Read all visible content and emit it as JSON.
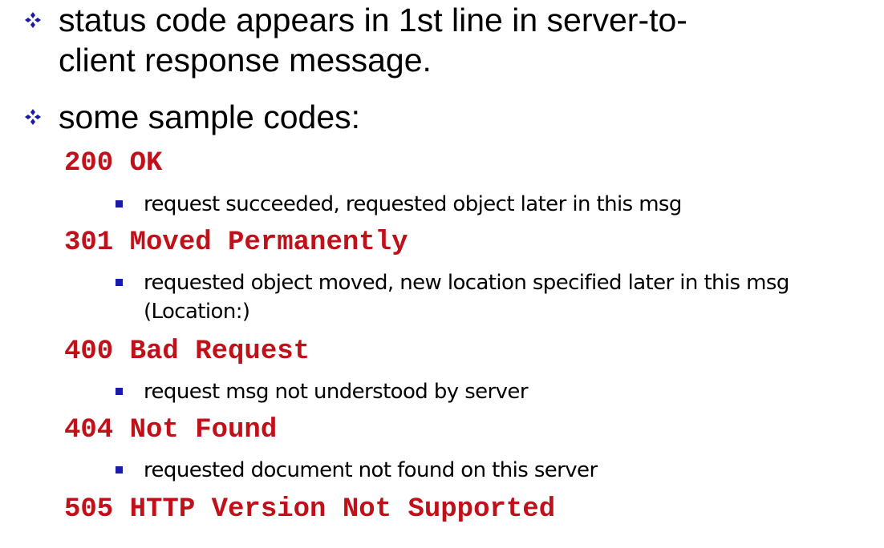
{
  "bullets": [
    {
      "line1": "status code appears in 1st line in server-to-",
      "line2": "client response message."
    },
    {
      "line1": "some sample codes:"
    }
  ],
  "codes": [
    {
      "code": "200 OK",
      "descriptions": [
        "request succeeded, requested object later in this msg"
      ]
    },
    {
      "code": "301 Moved Permanently",
      "descriptions": [
        "requested object moved, new location specified later in this msg",
        "(Location:)"
      ]
    },
    {
      "code": "400 Bad Request",
      "descriptions": [
        "request msg not understood by server"
      ]
    },
    {
      "code": "404 Not Found",
      "descriptions": [
        "requested document not found on this server"
      ]
    },
    {
      "code": "505 HTTP Version Not Supported",
      "descriptions": []
    }
  ],
  "colors": {
    "code_red": "#c0111b",
    "bullet_blue": "#1a1aa8",
    "text": "#000000"
  },
  "icons": {
    "level1": "four-diamond-bullet-icon",
    "level2": "square-bullet-icon"
  }
}
